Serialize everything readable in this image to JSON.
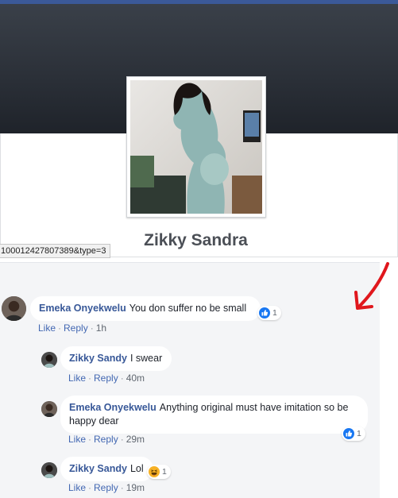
{
  "profile": {
    "name": "Zikky Sandra",
    "status_url": "100012427807389&type=3"
  },
  "comments": [
    {
      "author": "Emeka Onyekwelu",
      "text": "You don suffer no be small",
      "actions": {
        "like": "Like",
        "reply": "Reply",
        "sep": "·",
        "time": "1h"
      },
      "reaction": {
        "icon": "like-icon",
        "count": "1"
      }
    },
    {
      "author": "Zikky Sandy",
      "text": "I swear",
      "actions": {
        "like": "Like",
        "reply": "Reply",
        "sep": "·",
        "time": "40m"
      }
    },
    {
      "author": "Emeka Onyekwelu",
      "text": "Anything original must have imitation so be happy dear",
      "actions": {
        "like": "Like",
        "reply": "Reply",
        "sep": "·",
        "time": "29m"
      },
      "reaction": {
        "icon": "like-icon",
        "count": "1"
      }
    },
    {
      "author": "Zikky Sandy",
      "text": "Lol",
      "actions": {
        "like": "Like",
        "reply": "Reply",
        "sep": "·",
        "time": "19m"
      },
      "reaction": {
        "icon": "haha-icon",
        "count": "1"
      }
    }
  ],
  "colors": {
    "author": "#385898",
    "link": "#4267b2",
    "like_reaction": "#1877f2",
    "haha_reaction": "#f7b125",
    "annotation_arrow": "#e0171d"
  }
}
